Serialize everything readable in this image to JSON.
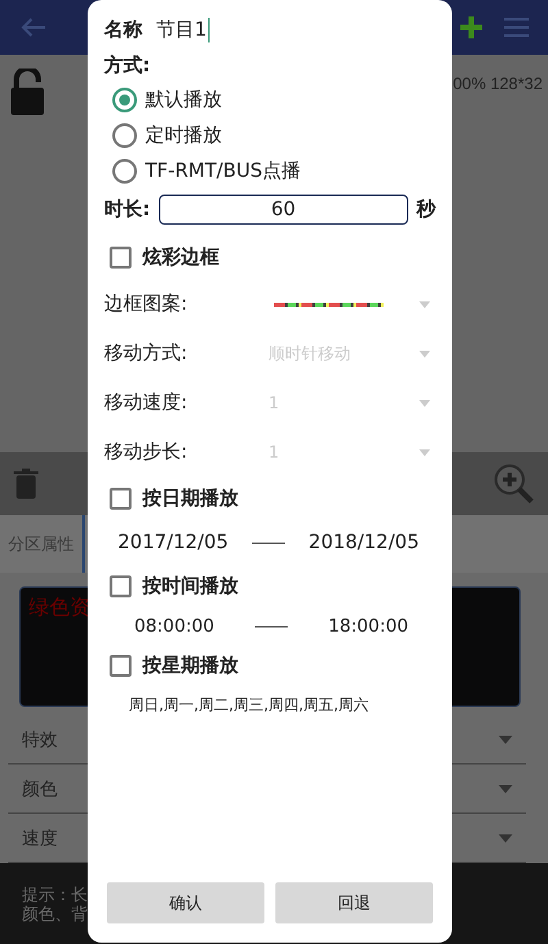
{
  "background": {
    "status_text": "00% 128*32",
    "tab": "分区属性",
    "preview_text": "绿色资",
    "rows": [
      {
        "label": "特效"
      },
      {
        "label": "颜色"
      },
      {
        "label": "速度"
      }
    ],
    "hint_lines": [
      "提示：长",
      "颜色、背"
    ]
  },
  "dialog": {
    "name": {
      "label": "名称",
      "value": "节目1"
    },
    "mode": {
      "label": "方式:",
      "options": [
        {
          "label": "默认播放",
          "selected": true
        },
        {
          "label": "定时播放",
          "selected": false
        },
        {
          "label": "TF-RMT/BUS点播",
          "selected": false
        }
      ]
    },
    "duration": {
      "label": "时长:",
      "value": "60",
      "unit": "秒"
    },
    "fancy_border": {
      "label": "炫彩边框",
      "checked": false
    },
    "settings": [
      {
        "kind": "pattern",
        "label": "边框图案:",
        "disabled": true
      },
      {
        "kind": "select",
        "label": "移动方式:",
        "value": "顺时针移动",
        "disabled": true
      },
      {
        "kind": "select",
        "label": "移动速度:",
        "value": "1",
        "disabled": true
      },
      {
        "kind": "select",
        "label": "移动步长:",
        "value": "1",
        "disabled": true
      }
    ],
    "date": {
      "label": "按日期播放",
      "checked": false,
      "start": "2017/12/05",
      "end": "2018/12/05"
    },
    "time": {
      "label": "按时间播放",
      "checked": false,
      "start": "08:00:00",
      "end": "18:00:00"
    },
    "week": {
      "label": "按星期播放",
      "checked": false,
      "days": "周日,周一,周二,周三,周四,周五,周六"
    },
    "buttons": [
      "确认",
      "回退"
    ]
  }
}
